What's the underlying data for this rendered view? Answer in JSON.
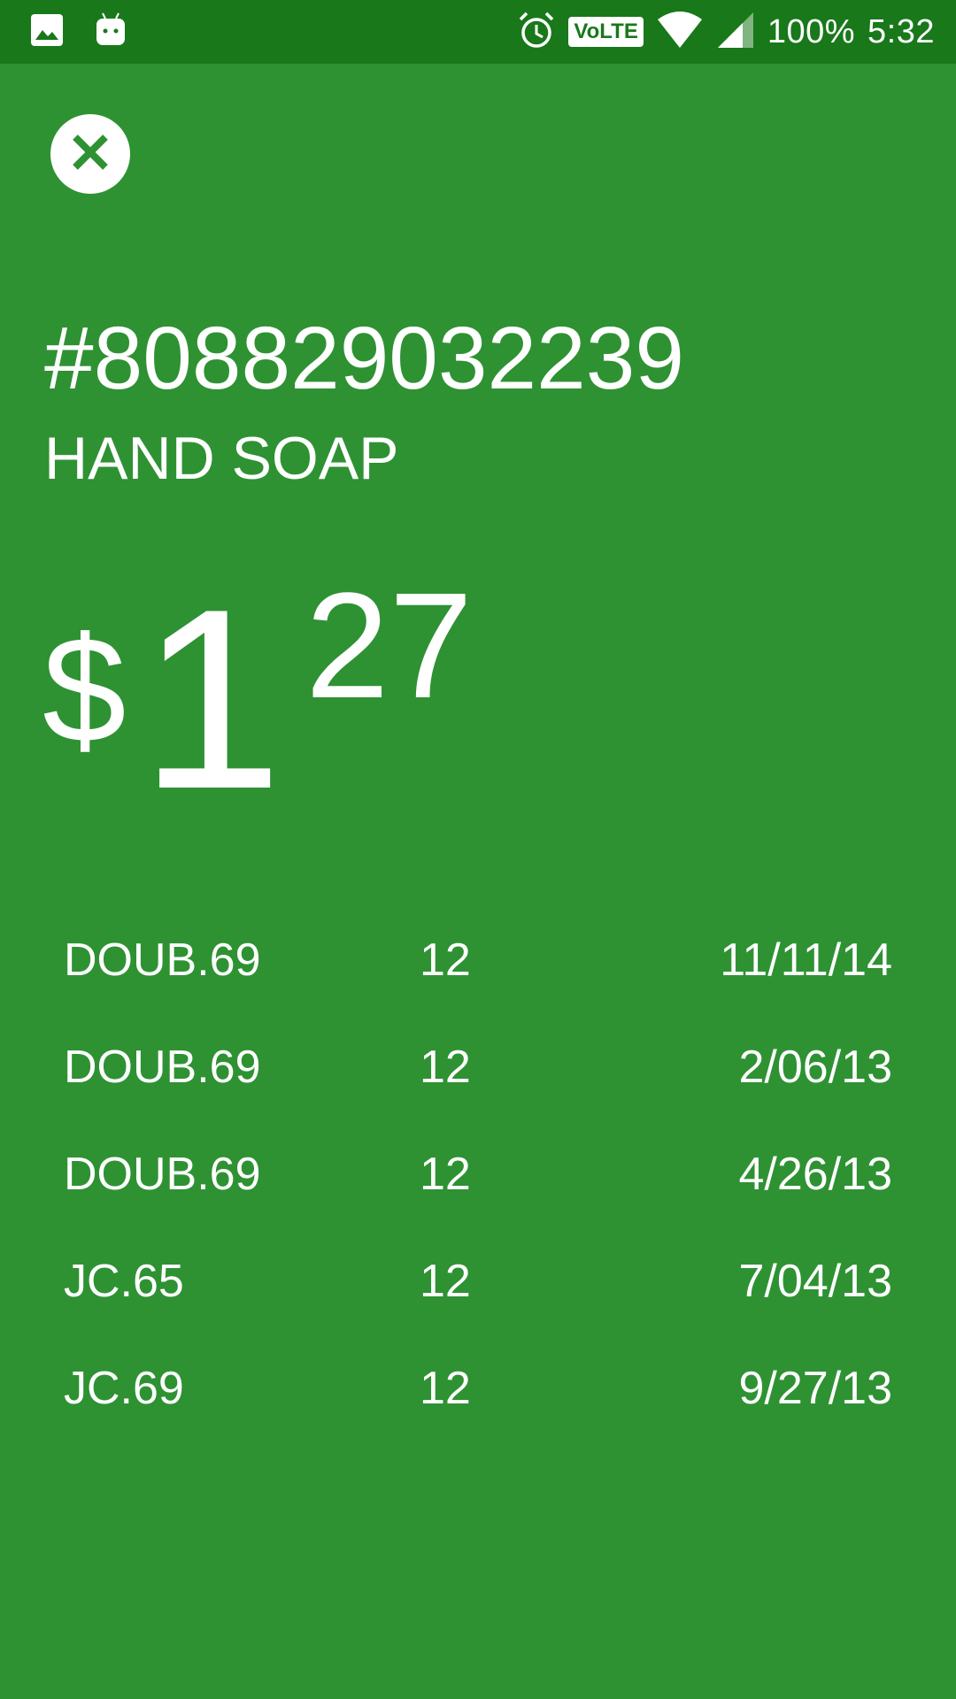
{
  "status_bar": {
    "left_icons": [
      "image-icon",
      "android-icon"
    ],
    "right_icons": [
      "alarm-icon",
      "volte-icon",
      "wifi-icon",
      "signal-icon"
    ],
    "volte_label": "VoLTE",
    "battery": "100%",
    "time": "5:32"
  },
  "item": {
    "number": "#808829032239",
    "name": "HAND SOAP"
  },
  "price": {
    "currency": "$",
    "whole": "1",
    "cents": "27"
  },
  "history": [
    {
      "store": "DOUB.69",
      "qty": "12",
      "date": "11/11/14"
    },
    {
      "store": "DOUB.69",
      "qty": "12",
      "date": "2/06/13"
    },
    {
      "store": "DOUB.69",
      "qty": "12",
      "date": "4/26/13"
    },
    {
      "store": "JC.65",
      "qty": "12",
      "date": "7/04/13"
    },
    {
      "store": "JC.69",
      "qty": "12",
      "date": "9/27/13"
    }
  ],
  "colors": {
    "background": "#2e9233",
    "status_bar": "#19781a",
    "text": "#ffffff"
  }
}
